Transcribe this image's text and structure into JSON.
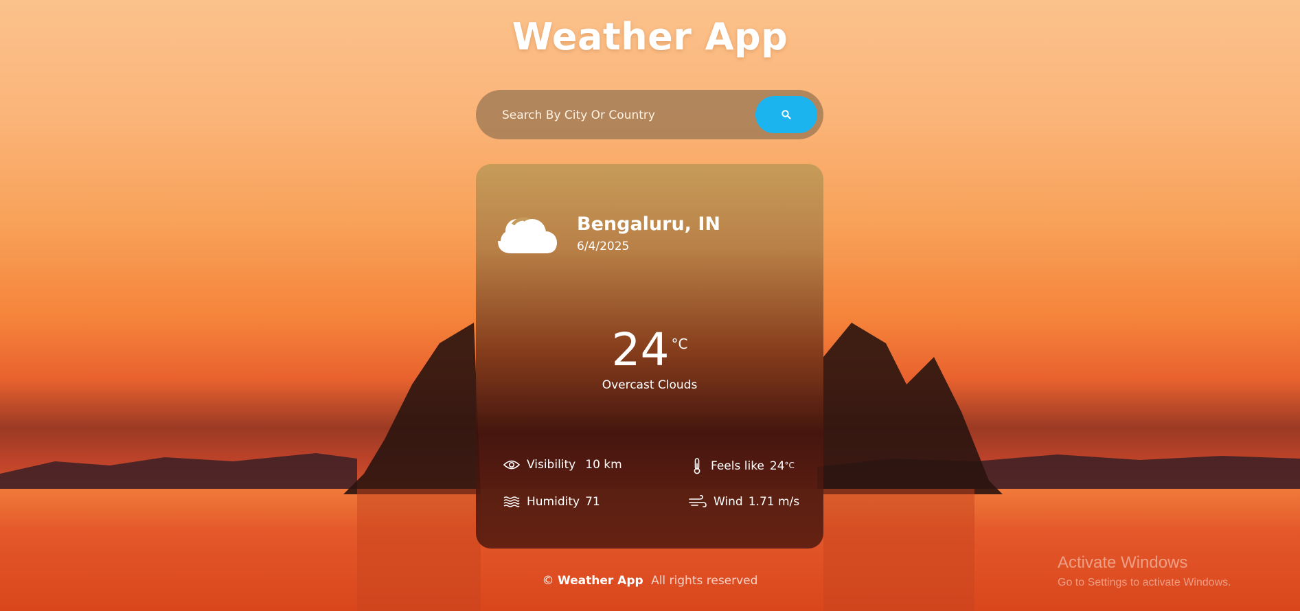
{
  "header": {
    "title": "Weather App"
  },
  "search": {
    "placeholder": "Search By City Or Country",
    "button_icon": "search-icon"
  },
  "weather": {
    "icon": "cloud-icon",
    "city": "Bengaluru, IN",
    "date": "6/4/2025",
    "temperature": "24",
    "temperature_unit": "°C",
    "description": "Overcast Clouds"
  },
  "details": {
    "visibility": {
      "icon": "eye-icon",
      "label": "Visibility",
      "value": "10 km"
    },
    "feels_like": {
      "icon": "thermometer-icon",
      "label": "Feels like",
      "value": "24",
      "unit": "°C"
    },
    "humidity": {
      "icon": "waves-icon",
      "label": "Humidity",
      "value": "71"
    },
    "wind": {
      "icon": "wind-icon",
      "label": "Wind",
      "value": "1.71 m/s"
    }
  },
  "footer": {
    "copyright": "©",
    "brand": "Weather App",
    "rights": "All rights reserved"
  },
  "watermark": {
    "line1": "Activate Windows",
    "line2": "Go to Settings to activate Windows."
  },
  "colors": {
    "accent": "#1bb4ee",
    "text": "#ffffff"
  }
}
